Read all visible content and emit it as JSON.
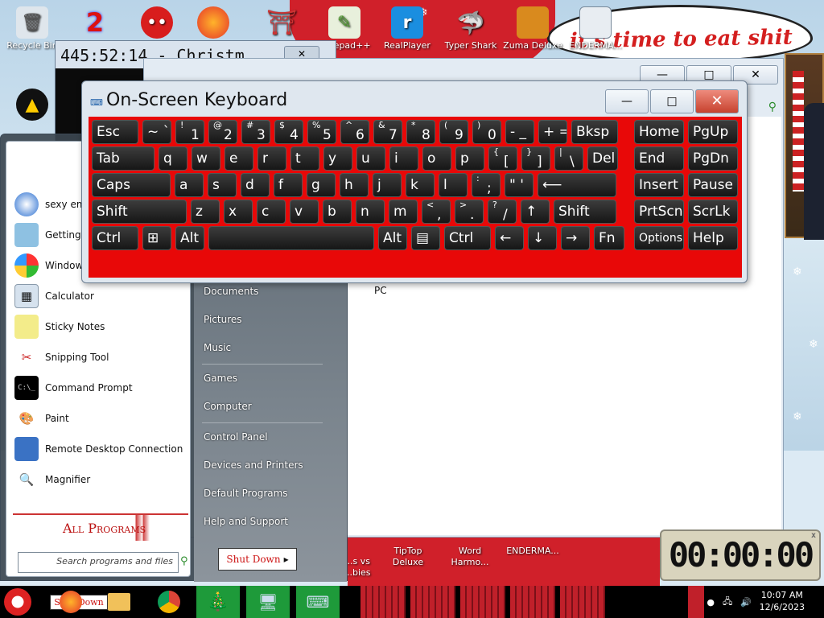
{
  "desktop": {
    "banner_text": "it's time to eat shit",
    "icons_top": [
      {
        "label": "Recycle Bin",
        "icon": "recycle-bin-icon"
      },
      {
        "label": "",
        "icon": "number-2-icon"
      },
      {
        "label": "",
        "icon": "red-creature-icon"
      },
      {
        "label": "",
        "icon": "firefox-icon"
      },
      {
        "label": "",
        "icon": "shrine-icon"
      },
      {
        "label": "Notepad++",
        "icon": "notepad-plus-plus-icon"
      },
      {
        "label": "RealPlayer",
        "icon": "realplayer-icon"
      },
      {
        "label": "Typer Shark",
        "icon": "typer-shark-icon"
      },
      {
        "label": "Zuma Deluxe",
        "icon": "zuma-icon"
      },
      {
        "label": "ENDERMA...",
        "icon": "endermanch-icon"
      }
    ],
    "icons_bottom": [
      {
        "label": "...s vs\n...bies",
        "icon": "plants-vs-zombies-icon"
      },
      {
        "label": "TipTop\nDeluxe",
        "icon": "tiptop-icon"
      },
      {
        "label": "Word\nHarmo...",
        "icon": "word-harmony-icon"
      },
      {
        "label": "ENDERMA...",
        "icon": "endermanch-icon"
      }
    ]
  },
  "back_window": {
    "title": "445:52:14 - Christm"
  },
  "explorer": {
    "pc_label": "PC",
    "help": "?",
    "close": "x"
  },
  "osk": {
    "title": "On-Screen Keyboard",
    "minimize": "—",
    "maximize": "□",
    "close": "✕",
    "rows": [
      [
        {
          "main": "Esc",
          "w": 58
        },
        {
          "main": "~ `",
          "w": 36
        },
        {
          "up": "!",
          "main": "1",
          "w": 36
        },
        {
          "up": "@",
          "main": "2",
          "w": 36
        },
        {
          "up": "#",
          "main": "3",
          "w": 36
        },
        {
          "up": "$",
          "main": "4",
          "w": 36
        },
        {
          "up": "%",
          "main": "5",
          "w": 36
        },
        {
          "up": "^",
          "main": "6",
          "w": 36
        },
        {
          "up": "&",
          "main": "7",
          "w": 36
        },
        {
          "up": "*",
          "main": "8",
          "w": 36
        },
        {
          "up": "(",
          "main": "9",
          "w": 36
        },
        {
          "up": ")",
          "main": "0",
          "w": 36
        },
        {
          "main": "- _",
          "w": 36
        },
        {
          "main": "+ =",
          "w": 36
        },
        {
          "main": "Bksp",
          "w": 58
        }
      ],
      [
        {
          "main": "Tab",
          "w": 78
        },
        {
          "main": "q",
          "w": 36
        },
        {
          "main": "w",
          "w": 36
        },
        {
          "main": "e",
          "w": 36
        },
        {
          "main": "r",
          "w": 36
        },
        {
          "main": "t",
          "w": 36
        },
        {
          "main": "y",
          "w": 36
        },
        {
          "main": "u",
          "w": 36
        },
        {
          "main": "i",
          "w": 36
        },
        {
          "main": "o",
          "w": 36
        },
        {
          "main": "p",
          "w": 36
        },
        {
          "up": "{",
          "main": "[",
          "w": 36
        },
        {
          "up": "}",
          "main": "]",
          "w": 36
        },
        {
          "up": "|",
          "main": "\\",
          "w": 36
        },
        {
          "main": "Del",
          "w": 38
        }
      ],
      [
        {
          "main": "Caps",
          "w": 98
        },
        {
          "main": "a",
          "w": 36
        },
        {
          "main": "s",
          "w": 36
        },
        {
          "main": "d",
          "w": 36
        },
        {
          "main": "f",
          "w": 36
        },
        {
          "main": "g",
          "w": 36
        },
        {
          "main": "h",
          "w": 36
        },
        {
          "main": "j",
          "w": 36
        },
        {
          "main": "k",
          "w": 36
        },
        {
          "main": "l",
          "w": 36
        },
        {
          "up": ":",
          "main": ";",
          "w": 36
        },
        {
          "main": "\" '",
          "w": 36
        },
        {
          "main": "⟵",
          "w": 98
        }
      ],
      [
        {
          "main": "Shift",
          "w": 118
        },
        {
          "main": "z",
          "w": 36
        },
        {
          "main": "x",
          "w": 36
        },
        {
          "main": "c",
          "w": 36
        },
        {
          "main": "v",
          "w": 36
        },
        {
          "main": "b",
          "w": 36
        },
        {
          "main": "n",
          "w": 36
        },
        {
          "main": "m",
          "w": 36
        },
        {
          "up": "<",
          "main": ",",
          "w": 36
        },
        {
          "up": ">",
          "main": ".",
          "w": 36
        },
        {
          "up": "?",
          "main": "/",
          "w": 36
        },
        {
          "main": "↑",
          "w": 36
        },
        {
          "main": "Shift",
          "w": 78
        }
      ],
      [
        {
          "main": "Ctrl",
          "w": 58
        },
        {
          "main": "⊞",
          "w": 36
        },
        {
          "main": "Alt",
          "w": 36
        },
        {
          "main": "",
          "w": 206
        },
        {
          "main": "Alt",
          "w": 36
        },
        {
          "main": "▤",
          "w": 36
        },
        {
          "main": "Ctrl",
          "w": 58
        },
        {
          "main": "←",
          "w": 36
        },
        {
          "main": "↓",
          "w": 36
        },
        {
          "main": "→",
          "w": 36
        },
        {
          "main": "Fn",
          "w": 38
        }
      ]
    ],
    "nav_rows": [
      [
        {
          "main": "Home"
        },
        {
          "main": "PgUp"
        }
      ],
      [
        {
          "main": "End"
        },
        {
          "main": "PgDn"
        }
      ],
      [
        {
          "main": "Insert"
        },
        {
          "main": "Pause"
        }
      ],
      [
        {
          "main": "PrtScn"
        },
        {
          "main": "ScrLk"
        }
      ],
      [
        {
          "main": "Options",
          "small": true
        },
        {
          "main": "Help"
        }
      ]
    ]
  },
  "start_menu": {
    "programs": [
      {
        "label": "sexy ema...",
        "icon": "thunderbird-icon"
      },
      {
        "label": "Getting S...",
        "icon": "getting-started-icon"
      },
      {
        "label": "Windows...",
        "icon": "windows-media-icon"
      },
      {
        "label": "Calculator",
        "icon": "calculator-icon"
      },
      {
        "label": "Sticky Notes",
        "icon": "sticky-notes-icon"
      },
      {
        "label": "Snipping Tool",
        "icon": "snipping-tool-icon"
      },
      {
        "label": "Command Prompt",
        "icon": "command-prompt-icon"
      },
      {
        "label": "Paint",
        "icon": "paint-icon"
      },
      {
        "label": "Remote Desktop Connection",
        "icon": "remote-desktop-icon"
      },
      {
        "label": "Magnifier",
        "icon": "magnifier-icon"
      }
    ],
    "all_programs": "All Programs",
    "search_placeholder": "Search programs and files",
    "right_links": [
      "Documents",
      "Pictures",
      "Music",
      "Games",
      "Computer",
      "Control Panel",
      "Devices and Printers",
      "Default Programs",
      "Help and Support"
    ],
    "shutdown": "Shut Down"
  },
  "timer": {
    "value": "00:00:00",
    "close": "x"
  },
  "taskbar": {
    "start_shutdown": "Shut Down",
    "time": "10:07 AM",
    "date": "12/6/2023"
  }
}
